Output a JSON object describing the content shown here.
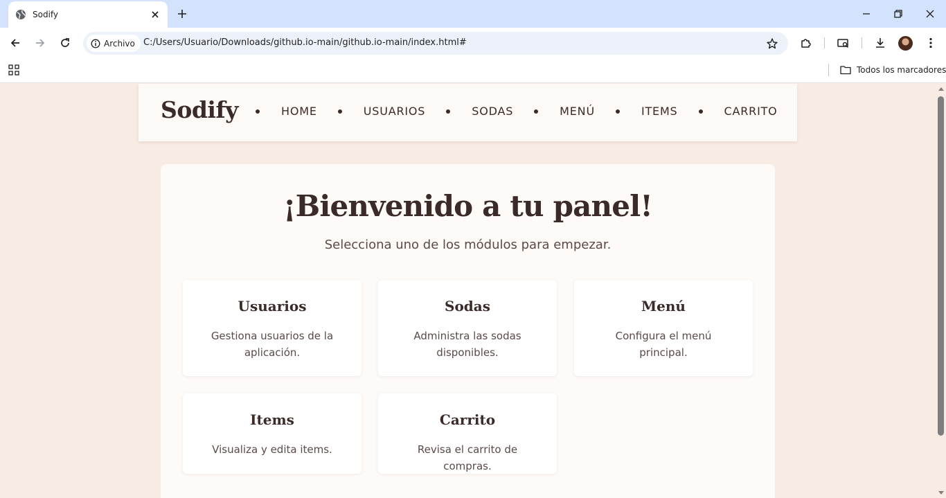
{
  "browser": {
    "tab_title": "Sodify",
    "address_chip": "Archivo",
    "url": "C:/Users/Usuario/Downloads/github.io-main/github.io-main/index.html#",
    "bookmarks_folder": "Todos los marcadores"
  },
  "site": {
    "brand": "Sodify",
    "nav": [
      "HOME",
      "USUARIOS",
      "SODAS",
      "MENÚ",
      "ITEMS",
      "CARRITO"
    ]
  },
  "panel": {
    "title": "¡Bienvenido a tu panel!",
    "subtitle": "Selecciona uno de los módulos para empezar.",
    "cards": [
      {
        "title": "Usuarios",
        "description": "Gestiona usuarios de la aplicación."
      },
      {
        "title": "Sodas",
        "description": "Administra las sodas disponibles."
      },
      {
        "title": "Menú",
        "description": "Configura el menú principal."
      },
      {
        "title": "Items",
        "description": "Visualiza y edita items."
      },
      {
        "title": "Carrito",
        "description": "Revisa el carrito de compras."
      }
    ]
  },
  "colors": {
    "page_background": "#f8ebe4",
    "text_dark": "#3a2a28",
    "tabstrip": "#d3e3fd"
  }
}
